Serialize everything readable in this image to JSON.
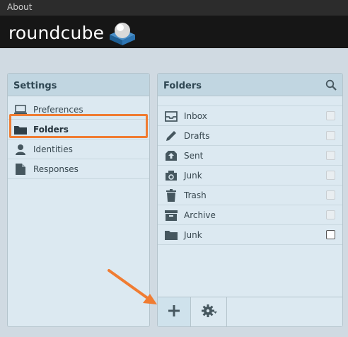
{
  "topbar": {
    "about_label": "About"
  },
  "logo": {
    "text": "roundcube"
  },
  "settings": {
    "title": "Settings",
    "items": [
      {
        "label": "Preferences",
        "icon": "computer-icon"
      },
      {
        "label": "Folders",
        "icon": "folder-icon",
        "selected": true
      },
      {
        "label": "Identities",
        "icon": "person-icon"
      },
      {
        "label": "Responses",
        "icon": "document-icon"
      }
    ]
  },
  "folders": {
    "title": "Folders",
    "rows": [
      {
        "label": "Inbox",
        "icon": "inbox-icon",
        "subscribed": true
      },
      {
        "label": "Drafts",
        "icon": "pencil-icon",
        "subscribed": true
      },
      {
        "label": "Sent",
        "icon": "sent-icon",
        "subscribed": true
      },
      {
        "label": "Junk",
        "icon": "recycle-icon",
        "subscribed": true
      },
      {
        "label": "Trash",
        "icon": "trash-icon",
        "subscribed": true
      },
      {
        "label": "Archive",
        "icon": "archive-icon",
        "subscribed": true
      },
      {
        "label": "Junk",
        "icon": "folder-icon",
        "subscribed": false
      }
    ]
  },
  "colors": {
    "highlight": "#f07c32",
    "panel": "#dce9f1",
    "header": "#c1d6e1"
  }
}
